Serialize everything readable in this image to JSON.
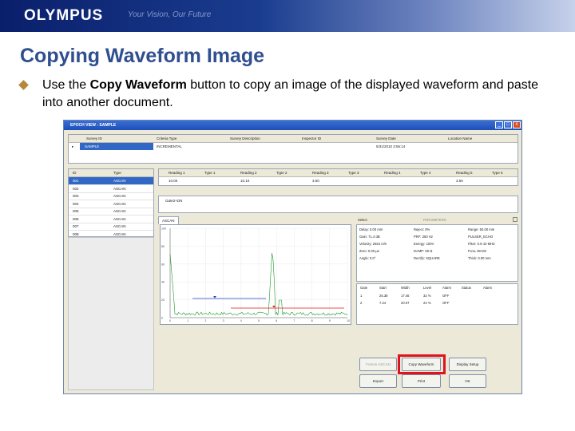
{
  "slide": {
    "logo": "OLYMPUS",
    "banner_text": "Your Vision, Our Future",
    "title": "Copying Waveform Image",
    "bullet_pre": "Use the ",
    "bullet_bold": "Copy Waveform",
    "bullet_post": " button to copy an image of the displayed waveform and paste into another document."
  },
  "window": {
    "title": "EPOCH VIEW - SAMPLE",
    "min": "_",
    "max": "□",
    "close": "x"
  },
  "survey": {
    "headers": [
      "Survey ID",
      "Criteria Type",
      "Survey Description",
      "Inspector ID",
      "Survey Date",
      "Location Name"
    ],
    "row": [
      "SAMPLE",
      "INCREMENTAL",
      "",
      "",
      "5/31/2010 3:56:14",
      ""
    ]
  },
  "ids": {
    "headers": [
      "ID",
      "Type"
    ],
    "rows": [
      [
        "001",
        "ASCAN"
      ],
      [
        "002",
        "ASCAN"
      ],
      [
        "003",
        "ASCAN"
      ],
      [
        "004",
        "ASCAN"
      ],
      [
        "005",
        "ASCAN"
      ],
      [
        "006",
        "ASCAN"
      ],
      [
        "007",
        "ASCAN"
      ],
      [
        "008",
        "ASCAN"
      ]
    ]
  },
  "readings": {
    "headers": [
      "Reading 1",
      "Type 1",
      "Reading 2",
      "Type 2",
      "Reading 3",
      "Type 3",
      "Reading 4",
      "Type 4",
      "Reading 5",
      "Type 5"
    ],
    "row": [
      "10.00",
      "",
      "10.10",
      "",
      "3.50",
      "",
      "",
      "",
      "3.50",
      ""
    ]
  },
  "gate_label": "Gate2+DN",
  "tab_label": "ASCAN",
  "select_label": "Select",
  "params_label": "PARAMETERS",
  "params": [
    [
      "Delay: 0.00 mm",
      "Gain: 71.4 dB",
      "Velocity: 2922 m/s",
      "Zero: 0.00 µs",
      "Angle: 0.0°"
    ],
    [
      "Reject: 0%",
      "PRF: 250 Hz",
      "Energy: 100V",
      "DAMP: 50 Ω",
      "Rectify: SQUARE"
    ],
    [
      "Range: 50.00 mm",
      "PULSER_ECHO",
      "Filter: 0.5-10 MHZ",
      "FULL WAVE",
      "Thick: 0.00 mm"
    ]
  ],
  "gates": {
    "headers": [
      "Gate",
      "Start",
      "Width",
      "Level",
      "Alarm",
      "Status",
      "Alarm"
    ],
    "rows": [
      [
        "1",
        "25.38",
        "17.46",
        "32 %",
        "OFF",
        "",
        ""
      ],
      [
        "2",
        "7.24",
        "20.07",
        "24 %",
        "OFF",
        "",
        ""
      ]
    ]
  },
  "plot": {
    "ytick_labels": [
      "100",
      "80",
      "60",
      "40",
      "20",
      "0"
    ],
    "xtick_labels": [
      "0",
      "1",
      "2",
      "3",
      "4",
      "5",
      "6",
      "7",
      "8",
      "9",
      "10"
    ]
  },
  "buttons": {
    "freeze": "Freeze ASCAN",
    "copy": "Copy Waveform",
    "display": "Display Setup",
    "export": "Export",
    "print": "Print",
    "ok": "OK"
  }
}
